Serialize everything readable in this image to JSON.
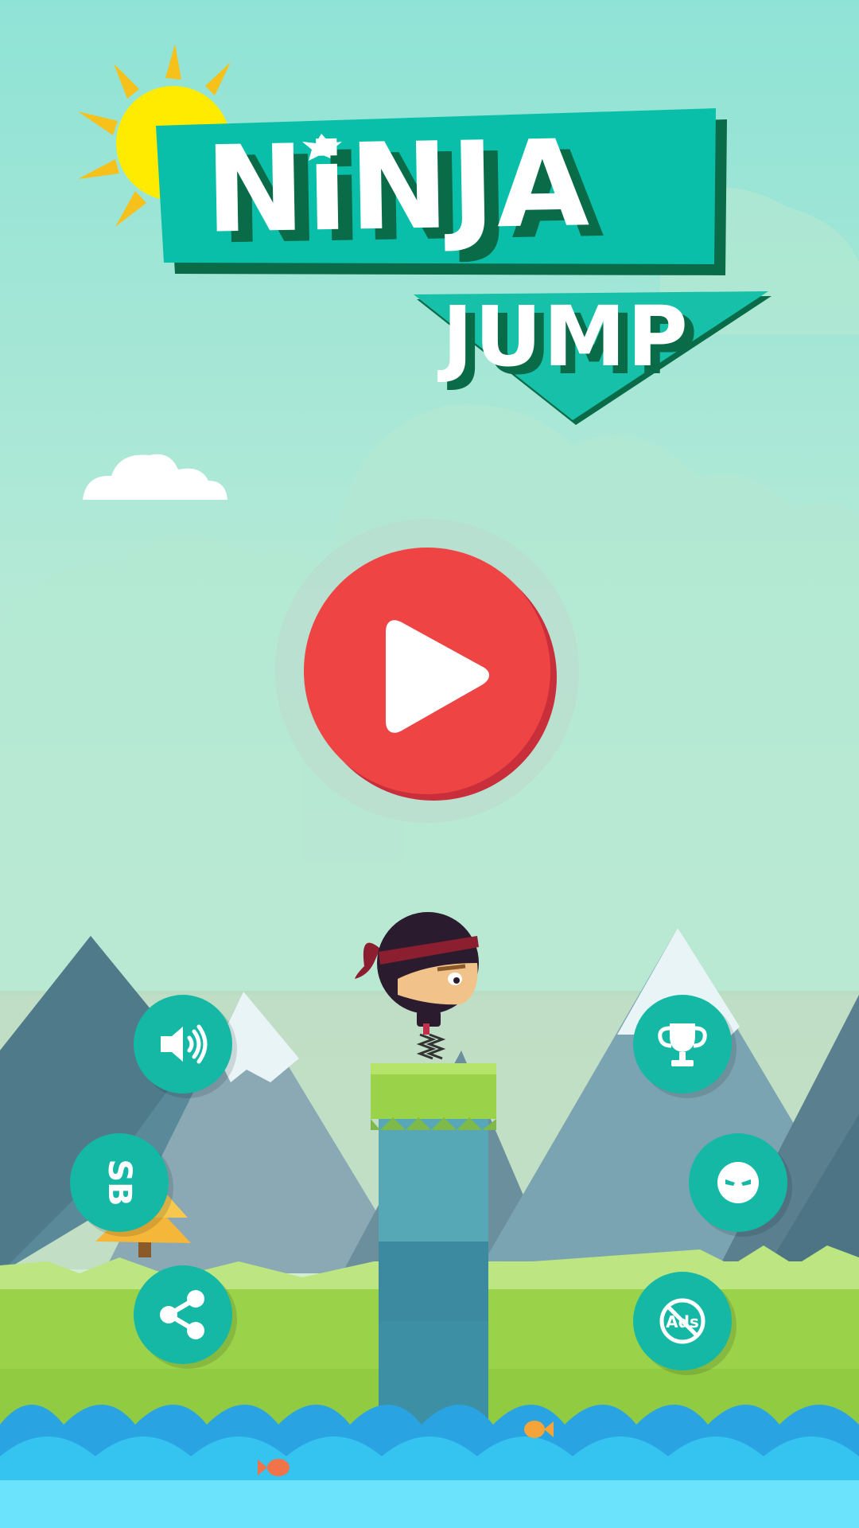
{
  "game": {
    "title_line1": "NiNJA",
    "title_line2": "JUMP"
  },
  "buttons": {
    "play": "play-icon",
    "sound": "speaker-icon",
    "leaderboard": "trophy-icon",
    "more_games": "sb-logo-icon",
    "characters": "ninja-face-icon",
    "share": "share-icon",
    "remove_ads": "no-ads-icon",
    "remove_ads_text": "Ads",
    "more_games_text": "SB"
  },
  "colors": {
    "sky": "#8fe3d6",
    "title_banner": "#0abfaa",
    "title_shadow": "#0a6b48",
    "play_button": "#ee4444",
    "round_button": "#15b8a5",
    "grass": "#9ad34a",
    "water": "#2fc3ee",
    "sun": "#ffeb00"
  }
}
